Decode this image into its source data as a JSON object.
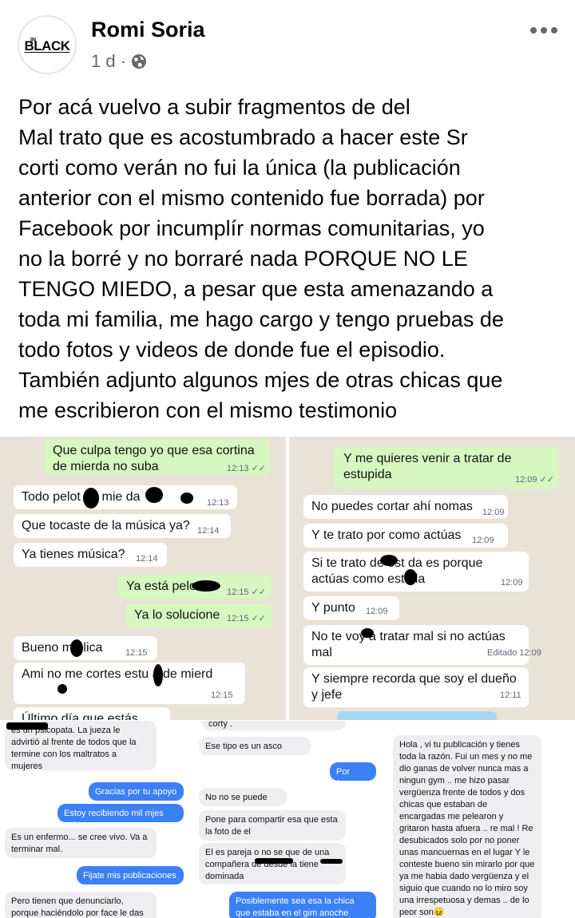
{
  "post": {
    "author": "Romi Soria",
    "time": "1 d ·",
    "avatar_logo": {
      "small": "IN",
      "main": "BLACK"
    },
    "text": "Por acá vuelvo a subir fragmentos de del\nMal trato que es acostumbrado a hacer este Sr\ncorti como verán no fui la única (la publicación\nanterior con el mismo contenido fue borrada) por\nFacebook por incumplír normas comunitarias, yo\nno la borré y no borraré nada PORQUE NO LE\nTENGO MIEDO, a pesar que esta amenazando a\ntoda mi familia, me hago cargo y tengo pruebas de\ntodo fotos y videos de donde fue el episodio.\nTambién adjunto algunos mjes de otras chicas que\nme escribieron con el mismo testimonio"
  },
  "chat1": [
    {
      "text": "Que culpa tengo yo que esa cortina de mierda no suba",
      "time": "12:13 ✓✓"
    },
    {
      "text": "Todo pelot   de mie    da",
      "time": "12:13"
    },
    {
      "text": "Que tocaste de la música ya?",
      "time": "12:14"
    },
    {
      "text": "Ya tienes música?",
      "time": "12:14"
    },
    {
      "text": "Ya está pelo",
      "time": "12:15 ✓✓"
    },
    {
      "text": "Ya lo solucione",
      "time": "12:15 ✓✓"
    },
    {
      "text": "Bueno mo   lica",
      "time": "12:15"
    },
    {
      "text": "Ami no me cortes estu   a de mierd",
      "time": "12:15"
    },
    {
      "text": "Último día que estás",
      "time": ""
    }
  ],
  "chat2": [
    {
      "text": "Y me quieres venir a tratar de estupida",
      "time": "12:09 ✓✓"
    },
    {
      "text": "No puedes cortar ahí nomas",
      "time": "12:09"
    },
    {
      "text": "Y te trato por como actúas",
      "time": "12:09"
    },
    {
      "text": "Si te trato de est   da es porque actúas como est   ida",
      "time": "12:09"
    },
    {
      "text": "Y punto",
      "time": "12:09"
    },
    {
      "text": "No te voy  a tratar mal si no actúas mal",
      "time": "Editado 12:09"
    },
    {
      "text": "Y siempre recorda que soy el dueño y jefe",
      "time": "12:11"
    }
  ],
  "msg1": [
    "es un psicopata. La jueza le advirtió al frente de todos que la termine con los maltratos a mujeres",
    "Gracias por tu apoyo",
    "Estoy recibiendo mil mjes así",
    "Es un enfermo... se cree vivo. Va a terminar mal.",
    "Fijate mis publicaciones",
    "Pero tienen que denunciarlo, porque haciéndolo por face le das"
  ],
  "msg2": [
    "corty .",
    "Ese tipo es un asco",
    "Por favor",
    "No no se puede",
    "Pone para compartir esa que esta la foto de el",
    "El es pareja o no se que de una compañera de             desde         la tiene dominada",
    "Posiblemente sea esa la chica que estaba en el gim anoche"
  ],
  "msg3": [
    "Hola , vi tu publicación y tienes toda la razón.  Fui  un mes y no me dio ganas de volver nunca mas a ningun gym ..  me hizo pasar vergüenza frente de todos y dos chicas que estaban de encargadas me pelearon y gritaron hasta afuera .. re mal ! Re desubicados solo por no poner unas mancuernas en el lugar  Y le conteste bueno sin mirarlo por que ya me habia dado vergüenza y el siguio que cuando no lo miro soy una irrespetuosa y demas .. de lo peor son😖"
  ],
  "colors": {
    "wa_bg": "#e9e2d7",
    "wa_out": "#d6f7c0",
    "ms_blue": "#3b80f5",
    "meta_gray": "#65676b"
  }
}
